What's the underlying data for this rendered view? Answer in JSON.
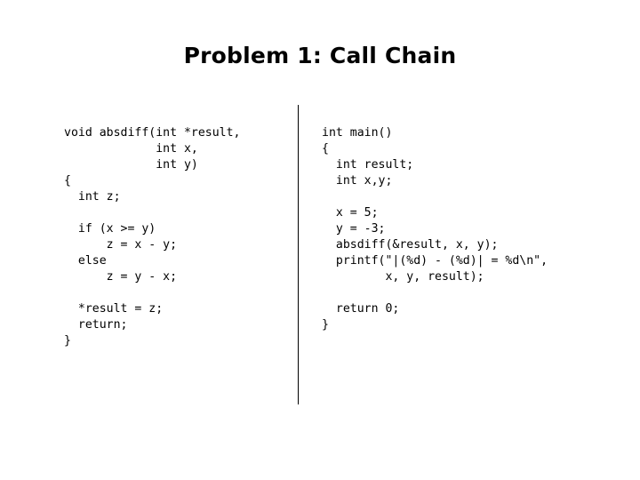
{
  "slide": {
    "title": "Problem 1: Call Chain",
    "background_color": "#ffffff",
    "text_color": "#000000",
    "divider_color": "#000000"
  },
  "code_left": {
    "name": "absdiff-function",
    "lines": [
      "void absdiff(int *result,",
      "             int x,",
      "             int y)",
      "{",
      "  int z;",
      "",
      "  if (x >= y)",
      "      z = x - y;",
      "  else",
      "      z = y - x;",
      "",
      "  *result = z;",
      "  return;",
      "}"
    ]
  },
  "code_right": {
    "name": "main-function",
    "lines": [
      "int main()",
      "{",
      "  int result;",
      "  int x,y;",
      "",
      "  x = 5;",
      "  y = -3;",
      "  absdiff(&result, x, y);",
      "  printf(\"|(%d) - (%d)| = %d\\n\",",
      "         x, y, result);",
      "",
      "  return 0;",
      "}"
    ]
  }
}
